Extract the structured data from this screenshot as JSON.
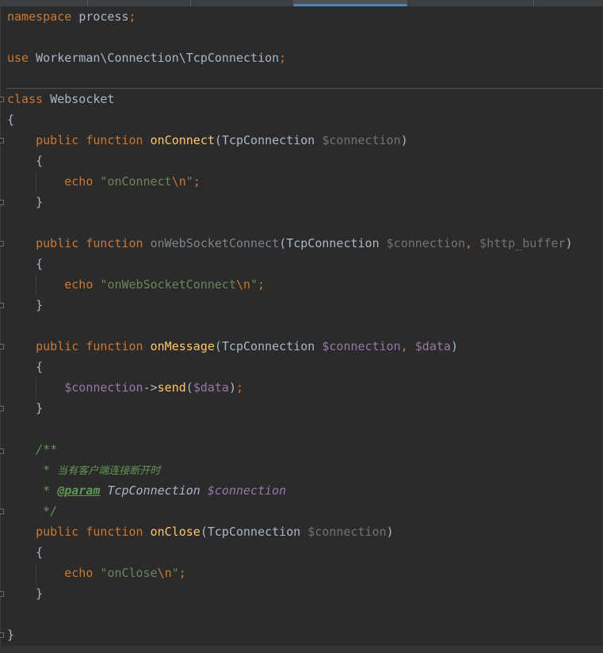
{
  "file": {
    "namespace_kw": "namespace",
    "namespace_name": "process",
    "use_kw": "use",
    "use_path": "Workerman\\Connection\\TcpConnection",
    "class_kw": "class",
    "class_name": "Websocket",
    "public_kw": "public",
    "function_kw": "function",
    "echo_kw": "echo",
    "type_name": "TcpConnection",
    "semicolon": ";",
    "open_brace": "{",
    "close_brace": "}",
    "open_paren": "(",
    "close_paren": ")",
    "comma": ",",
    "arrow": "->",
    "newline_escape": "\\n",
    "quote": "\""
  },
  "methods": [
    {
      "name": "onConnect",
      "params": [
        "$connection"
      ],
      "body_string": "onConnect"
    },
    {
      "name": "onWebSocketConnect",
      "params": [
        "$connection",
        "$http_buffer"
      ],
      "body_string": "onWebSocketConnect"
    },
    {
      "name": "onMessage",
      "params": [
        "$connection",
        "$data"
      ],
      "body_var": "$connection",
      "body_call": "send",
      "body_arg": "$data"
    },
    {
      "name": "onClose",
      "params": [
        "$connection"
      ],
      "body_string": "onClose",
      "docblock": {
        "open": "/**",
        "star": "*",
        "description": "当有客户端连接断开时",
        "tag": "@param",
        "tag_type": "TcpConnection",
        "tag_var": "$connection",
        "close": "*/"
      }
    }
  ],
  "colors": {
    "background": "#2b2b2b",
    "keyword": "#cc7832",
    "function": "#ffc66d",
    "variable": "#9876aa",
    "string": "#6a8759",
    "doc_comment": "#629755",
    "default_text": "#a9b7c6"
  },
  "icons": {
    "fold_marker": "fold-marker-icon"
  }
}
